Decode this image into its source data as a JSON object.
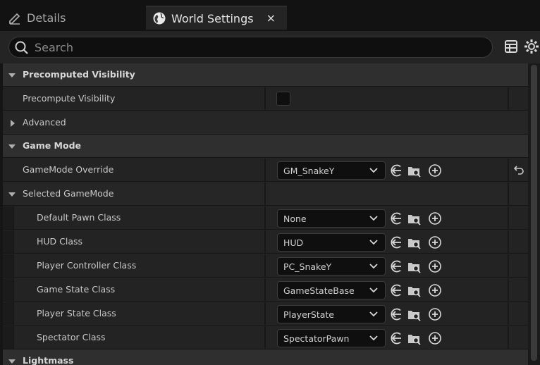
{
  "tabs": {
    "details_label": "Details",
    "world_label": "World Settings",
    "close_glyph": "×"
  },
  "search": {
    "placeholder": "Search"
  },
  "sections": {
    "precomputed_visibility": "Precomputed Visibility",
    "precompute_visibility_label": "Precompute Visibility",
    "advanced": "Advanced",
    "game_mode": "Game Mode",
    "gamemode_override_label": "GameMode Override",
    "gamemode_override_value": "GM_SnakeY",
    "selected_gamemode": "Selected GameMode",
    "lightmass": "Lightmass"
  },
  "class_rows": [
    {
      "label": "Default Pawn Class",
      "value": "None"
    },
    {
      "label": "HUD Class",
      "value": "HUD"
    },
    {
      "label": "Player Controller Class",
      "value": "PC_SnakeY"
    },
    {
      "label": "Game State Class",
      "value": "GameStateBase"
    },
    {
      "label": "Player State Class",
      "value": "PlayerState"
    },
    {
      "label": "Spectator Class",
      "value": "SpectatorPawn"
    }
  ],
  "icons": {
    "details_tab": "pencil-icon",
    "world_tab": "globe-icon",
    "search": "search-icon",
    "table_view": "table-icon",
    "settings": "gear-icon",
    "use_selected": "arrow-left-circle-icon",
    "browse": "folder-search-icon",
    "add": "plus-circle-icon",
    "reset": "reset-arrow-icon"
  },
  "colors": {
    "background": "#151515",
    "panel": "#242424",
    "category_row": "#2f2f2f",
    "field": "#0f0f0f",
    "text": "#c8c8c8"
  }
}
